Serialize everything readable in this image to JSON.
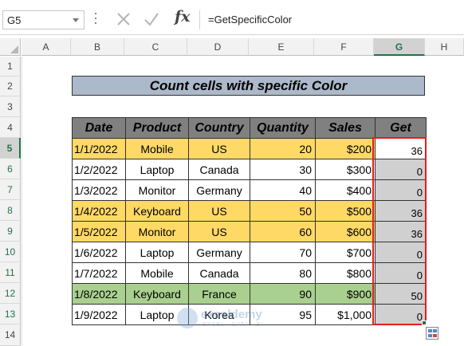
{
  "formula_bar": {
    "name_box": "G5",
    "fx_label": "fx",
    "formula": "=GetSpecificColor"
  },
  "columns": [
    "A",
    "B",
    "C",
    "D",
    "E",
    "F",
    "G",
    "H"
  ],
  "rows": [
    "1",
    "2",
    "3",
    "4",
    "5",
    "6",
    "7",
    "8",
    "9",
    "10",
    "11",
    "12",
    "13",
    "14"
  ],
  "selected_cell": "G5",
  "title": "Count cells with specific Color",
  "table": {
    "headers": [
      "Date",
      "Product",
      "Country",
      "Quantity",
      "Sales",
      "Get"
    ],
    "rows": [
      {
        "date": "1/1/2022",
        "product": "Mobile",
        "country": "US",
        "quantity": "20",
        "sales": "$200",
        "get": "36",
        "fill": "yellow"
      },
      {
        "date": "1/2/2022",
        "product": "Laptop",
        "country": "Canada",
        "quantity": "30",
        "sales": "$300",
        "get": "0",
        "fill": "none"
      },
      {
        "date": "1/3/2022",
        "product": "Monitor",
        "country": "Germany",
        "quantity": "40",
        "sales": "$400",
        "get": "0",
        "fill": "none"
      },
      {
        "date": "1/4/2022",
        "product": "Keyboard",
        "country": "US",
        "quantity": "50",
        "sales": "$500",
        "get": "36",
        "fill": "yellow"
      },
      {
        "date": "1/5/2022",
        "product": "Monitor",
        "country": "US",
        "quantity": "60",
        "sales": "$600",
        "get": "36",
        "fill": "yellow"
      },
      {
        "date": "1/6/2022",
        "product": "Laptop",
        "country": "Germany",
        "quantity": "70",
        "sales": "$700",
        "get": "0",
        "fill": "none"
      },
      {
        "date": "1/7/2022",
        "product": "Mobile",
        "country": "Canada",
        "quantity": "80",
        "sales": "$800",
        "get": "0",
        "fill": "none"
      },
      {
        "date": "1/8/2022",
        "product": "Keyboard",
        "country": "France",
        "quantity": "90",
        "sales": "$900",
        "get": "50",
        "fill": "green"
      },
      {
        "date": "1/9/2022",
        "product": "Laptop",
        "country": "Korea",
        "quantity": "95",
        "sales": "$1,000",
        "get": "0",
        "fill": "none"
      }
    ]
  },
  "colors": {
    "yellow_fill": "#ffd966",
    "green_fill": "#a9d08e",
    "title_fill": "#acb9ca",
    "header_fill": "#808080",
    "get_fill": "#d0d0d0",
    "selection_outline": "#e02020",
    "excel_green": "#217346"
  },
  "watermark": {
    "name": "exceldemy",
    "tagline": "EXCEL · DATA · BI"
  }
}
